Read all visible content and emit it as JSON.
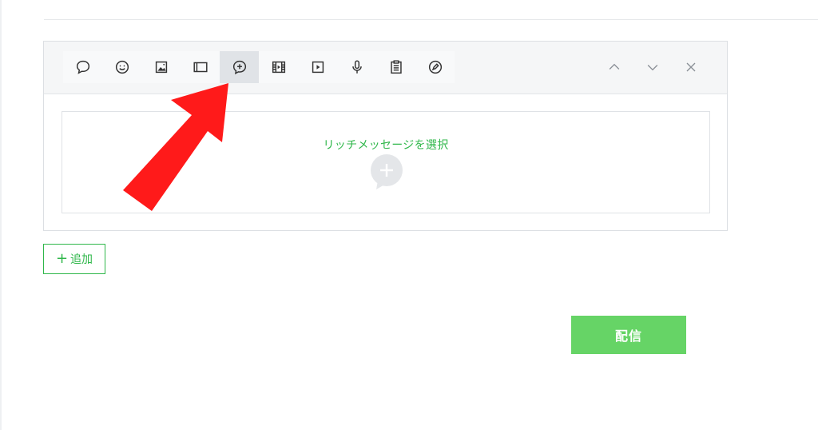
{
  "toolbar": {
    "tools": [
      {
        "icon": "speech-bubble-icon",
        "name": "text"
      },
      {
        "icon": "smiley-icon",
        "name": "sticker"
      },
      {
        "icon": "image-icon",
        "name": "photo"
      },
      {
        "icon": "card-icon",
        "name": "card"
      },
      {
        "icon": "rich-message-icon",
        "name": "rich-message",
        "active": true
      },
      {
        "icon": "video-film-icon",
        "name": "rich-video"
      },
      {
        "icon": "video-play-icon",
        "name": "video"
      },
      {
        "icon": "microphone-icon",
        "name": "voice"
      },
      {
        "icon": "clipboard-icon",
        "name": "survey"
      },
      {
        "icon": "coupon-pen-icon",
        "name": "coupon"
      }
    ],
    "nav": [
      "chevron-up-icon",
      "chevron-down-icon",
      "close-icon"
    ]
  },
  "drop_zone": {
    "label": "リッチメッセージを選択"
  },
  "add_button": {
    "label": "追加"
  },
  "send_button": {
    "label": "配信"
  },
  "colors": {
    "accent": "#2fb74a",
    "send": "#66d466",
    "arrow": "#ff1a1a"
  }
}
